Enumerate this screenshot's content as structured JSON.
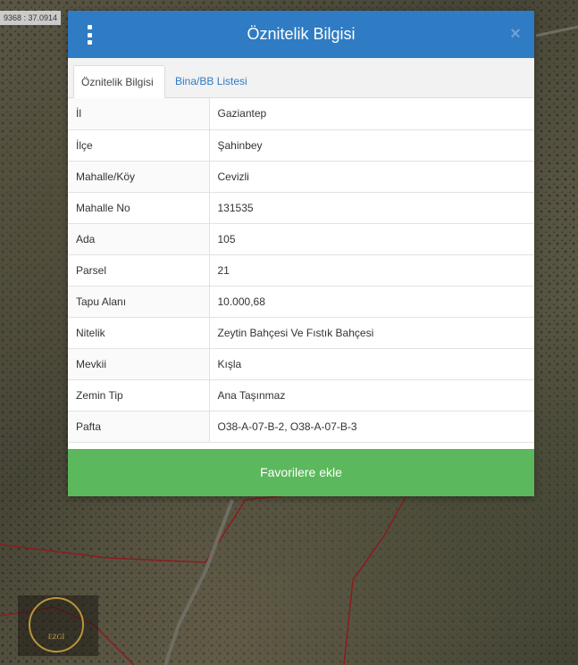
{
  "map": {
    "coordinate_readout": "9368 : 37.0914"
  },
  "modal": {
    "title": "Öznitelik Bilgisi",
    "close_glyph": "×",
    "tabs": [
      {
        "label": "Öznitelik Bilgisi",
        "active": true
      },
      {
        "label": "Bina/BB Listesi",
        "active": false
      }
    ],
    "rows": [
      {
        "key": "İl",
        "value": "Gaziantep"
      },
      {
        "key": "İlçe",
        "value": "Şahinbey"
      },
      {
        "key": "Mahalle/Köy",
        "value": "Cevizli"
      },
      {
        "key": "Mahalle No",
        "value": "131535"
      },
      {
        "key": "Ada",
        "value": "105"
      },
      {
        "key": "Parsel",
        "value": "21"
      },
      {
        "key": "Tapu Alanı",
        "value": "10.000,68"
      },
      {
        "key": "Nitelik",
        "value": "Zeytin Bahçesi Ve Fıstık Bahçesi"
      },
      {
        "key": "Mevkii",
        "value": "Kışla"
      },
      {
        "key": "Zemin Tip",
        "value": "Ana Taşınmaz"
      },
      {
        "key": "Pafta",
        "value": "O38-A-07-B-2, O38-A-07-B-3"
      }
    ],
    "favorite_button_label": "Favorilere ekle"
  },
  "logo": {
    "text": "EZGİ"
  },
  "colors": {
    "header": "#2f7bc4",
    "favorite_button": "#5cb85c",
    "parcel_border": "#c0282a"
  },
  "icons": [
    "kebab-menu-icon",
    "close-icon"
  ]
}
